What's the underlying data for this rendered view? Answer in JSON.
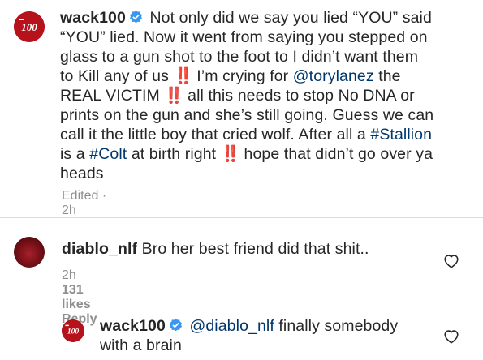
{
  "comments": [
    {
      "username": "wack100",
      "verified": true,
      "avatar": "wack100-brand-logo",
      "lines": [
        [
          {
            "t": "text",
            "v": "Not only did we say you lied “YOU” said"
          }
        ],
        [
          {
            "t": "text",
            "v": "“YOU” lied. Now it went from saying you stepped on"
          }
        ],
        [
          {
            "t": "text",
            "v": "glass to a gun shot to the foot to I didn’t want them"
          }
        ],
        [
          {
            "t": "text",
            "v": "to Kill any of us "
          },
          {
            "t": "bang",
            "v": "‼️"
          },
          {
            "t": "text",
            "v": " I’m crying for "
          },
          {
            "t": "mention",
            "v": "@torylanez"
          },
          {
            "t": "text",
            "v": " the"
          }
        ],
        [
          {
            "t": "text",
            "v": "REAL VICTIM "
          },
          {
            "t": "bang",
            "v": "‼️"
          },
          {
            "t": "text",
            "v": " all this needs to stop No DNA or"
          }
        ],
        [
          {
            "t": "text",
            "v": "prints on the gun and she’s still going. Guess we can"
          }
        ],
        [
          {
            "t": "text",
            "v": "call it the little boy that cried wolf. After all a "
          },
          {
            "t": "hashtag",
            "v": "#Stallion"
          }
        ],
        [
          {
            "t": "text",
            "v": "is a "
          },
          {
            "t": "hashtag",
            "v": "#Colt"
          },
          {
            "t": "text",
            "v": " at birth right "
          },
          {
            "t": "bang",
            "v": "‼️"
          },
          {
            "t": "text",
            "v": " hope that didn’t go over ya"
          }
        ],
        [
          {
            "t": "text",
            "v": "heads"
          }
        ]
      ],
      "meta": {
        "edited": "Edited · 2h"
      }
    },
    {
      "username": "diablo_nlf",
      "verified": false,
      "avatar": "diablo-avatar",
      "body": "Bro her best friend did that shit..",
      "meta": {
        "time": "2h",
        "likes": "131 likes",
        "reply": "Reply"
      }
    },
    {
      "username": "wack100",
      "verified": true,
      "avatar": "wack100-brand-logo",
      "lines": [
        [
          {
            "t": "mention",
            "v": "@diablo_nlf"
          },
          {
            "t": "text",
            "v": " finally somebody"
          }
        ],
        [
          {
            "t": "text",
            "v": "with a brain"
          }
        ]
      ]
    }
  ],
  "colors": {
    "text": "#262626",
    "muted": "#8e8e8e",
    "link": "#00376b",
    "verified": "#3897f0",
    "brand_red": "#b5121b",
    "exclaim": "#ed1c24"
  }
}
